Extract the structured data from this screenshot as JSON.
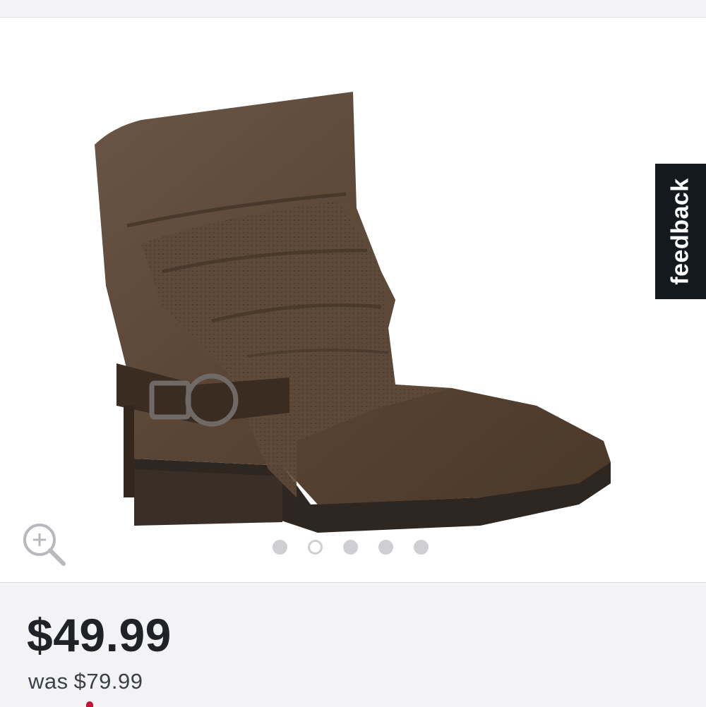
{
  "gallery": {
    "images_count": 5,
    "active_index": 1,
    "product_image_alt": "brown slouch ankle boot with buckle strap",
    "zoom_icon": "zoom-in-icon"
  },
  "feedback": {
    "label": "feedback"
  },
  "pricing": {
    "price": "$49.99",
    "was_label": "was",
    "was_price": "$79.99"
  },
  "colors": {
    "background": "#f3f3f5",
    "feedback_tab": "#14191f",
    "price_text": "#1f2328",
    "accent": "#c0123a"
  }
}
